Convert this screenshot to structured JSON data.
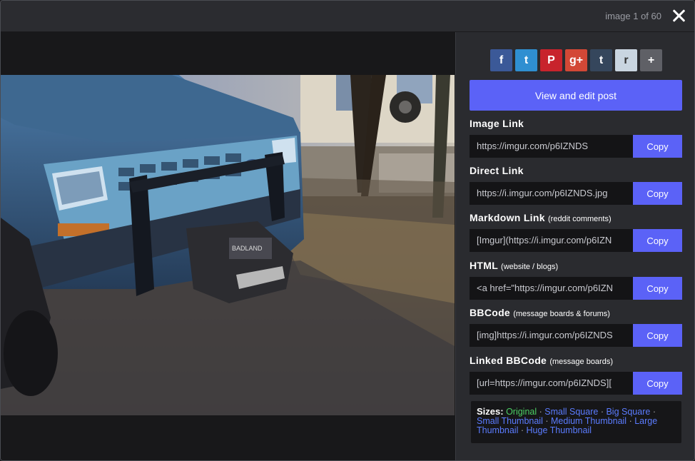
{
  "header": {
    "counter": "image 1 of 60"
  },
  "social": [
    {
      "icon": "facebook-icon",
      "glyph": "f",
      "color": "#3b5998"
    },
    {
      "icon": "twitter-icon",
      "glyph": "t",
      "color": "#2f8fd1"
    },
    {
      "icon": "pinterest-icon",
      "glyph": "P",
      "color": "#c8232c"
    },
    {
      "icon": "google-plus-icon",
      "glyph": "g+",
      "color": "#d34836"
    },
    {
      "icon": "tumblr-icon",
      "glyph": "t",
      "color": "#35465c"
    },
    {
      "icon": "reddit-icon",
      "glyph": "r",
      "color": "#c9d5e0"
    },
    {
      "icon": "plus-icon",
      "glyph": "+",
      "color": "#5f6066"
    }
  ],
  "sidebar": {
    "view_edit_label": "View and edit post",
    "copy_label": "Copy",
    "groups": [
      {
        "label": "Image Link",
        "hint": "",
        "value": "https://imgur.com/p6IZNDS"
      },
      {
        "label": "Direct Link",
        "hint": "",
        "value": "https://i.imgur.com/p6IZNDS.jpg"
      },
      {
        "label": "Markdown Link",
        "hint": "(reddit comments)",
        "value": "[Imgur](https://i.imgur.com/p6IZN"
      },
      {
        "label": "HTML",
        "hint": "(website / blogs)",
        "value": "<a href=\"https://imgur.com/p6IZN"
      },
      {
        "label": "BBCode",
        "hint": "(message boards & forums)",
        "value": "[img]https://i.imgur.com/p6IZNDS"
      },
      {
        "label": "Linked BBCode",
        "hint": "(message boards)",
        "value": "[url=https://imgur.com/p6IZNDS]["
      }
    ],
    "sizes": {
      "label": "Sizes:",
      "original": "Original",
      "links": [
        "Small Square",
        "Big Square",
        "Small Thumbnail",
        "Medium Thumbnail",
        "Large Thumbnail",
        "Huge Thumbnail"
      ],
      "separator": "·"
    }
  }
}
